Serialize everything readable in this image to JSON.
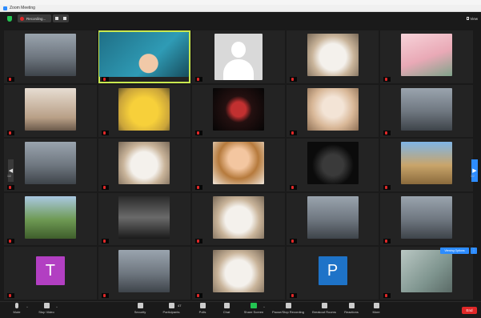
{
  "window": {
    "title": "Zoom Meeting"
  },
  "meeting_bar": {
    "recording_label": "Recording...",
    "view_label": "View"
  },
  "colors": {
    "active_speaker": "#c9e84f",
    "recording": "#e02828",
    "share": "#23c552",
    "accent": "#2d8cff",
    "end": "#e02828"
  },
  "pagination": {
    "left": "1/2",
    "right": "1/2"
  },
  "viewing": {
    "label": "Viewing Options"
  },
  "tiles": [
    {
      "name": "",
      "kind": "person"
    },
    {
      "name": "",
      "kind": "active"
    },
    {
      "name": "",
      "kind": "avatar"
    },
    {
      "name": "",
      "kind": "cat"
    },
    {
      "name": "",
      "kind": "pink"
    },
    {
      "name": "",
      "kind": "room"
    },
    {
      "name": "",
      "kind": "duck"
    },
    {
      "name": "",
      "kind": "emblem"
    },
    {
      "name": "",
      "kind": "bride"
    },
    {
      "name": "",
      "kind": "person"
    },
    {
      "name": "",
      "kind": "person"
    },
    {
      "name": "",
      "kind": "cat"
    },
    {
      "name": "",
      "kind": "cartoon"
    },
    {
      "name": "",
      "kind": "darkcat"
    },
    {
      "name": "",
      "kind": "dog"
    },
    {
      "name": "",
      "kind": "garden"
    },
    {
      "name": "",
      "kind": "poster"
    },
    {
      "name": "",
      "kind": "cat"
    },
    {
      "name": "",
      "kind": "person"
    },
    {
      "name": "",
      "kind": "person"
    },
    {
      "name": "",
      "kind": "letter",
      "letter": "T"
    },
    {
      "name": "",
      "kind": "person"
    },
    {
      "name": "",
      "kind": "cat"
    },
    {
      "name": "",
      "kind": "letter",
      "letter": "P"
    },
    {
      "name": "",
      "kind": "blur"
    }
  ],
  "toolbar": {
    "mute": "Mute",
    "stop_video": "Stop Video",
    "security": "Security",
    "participants": "Participants",
    "participants_count": "47",
    "polls": "Polls",
    "chat": "Chat",
    "share": "Share Screen",
    "record": "Pause/Stop Recording",
    "breakout": "Breakout Rooms",
    "reactions": "Reactions",
    "more": "More",
    "end": "End"
  }
}
